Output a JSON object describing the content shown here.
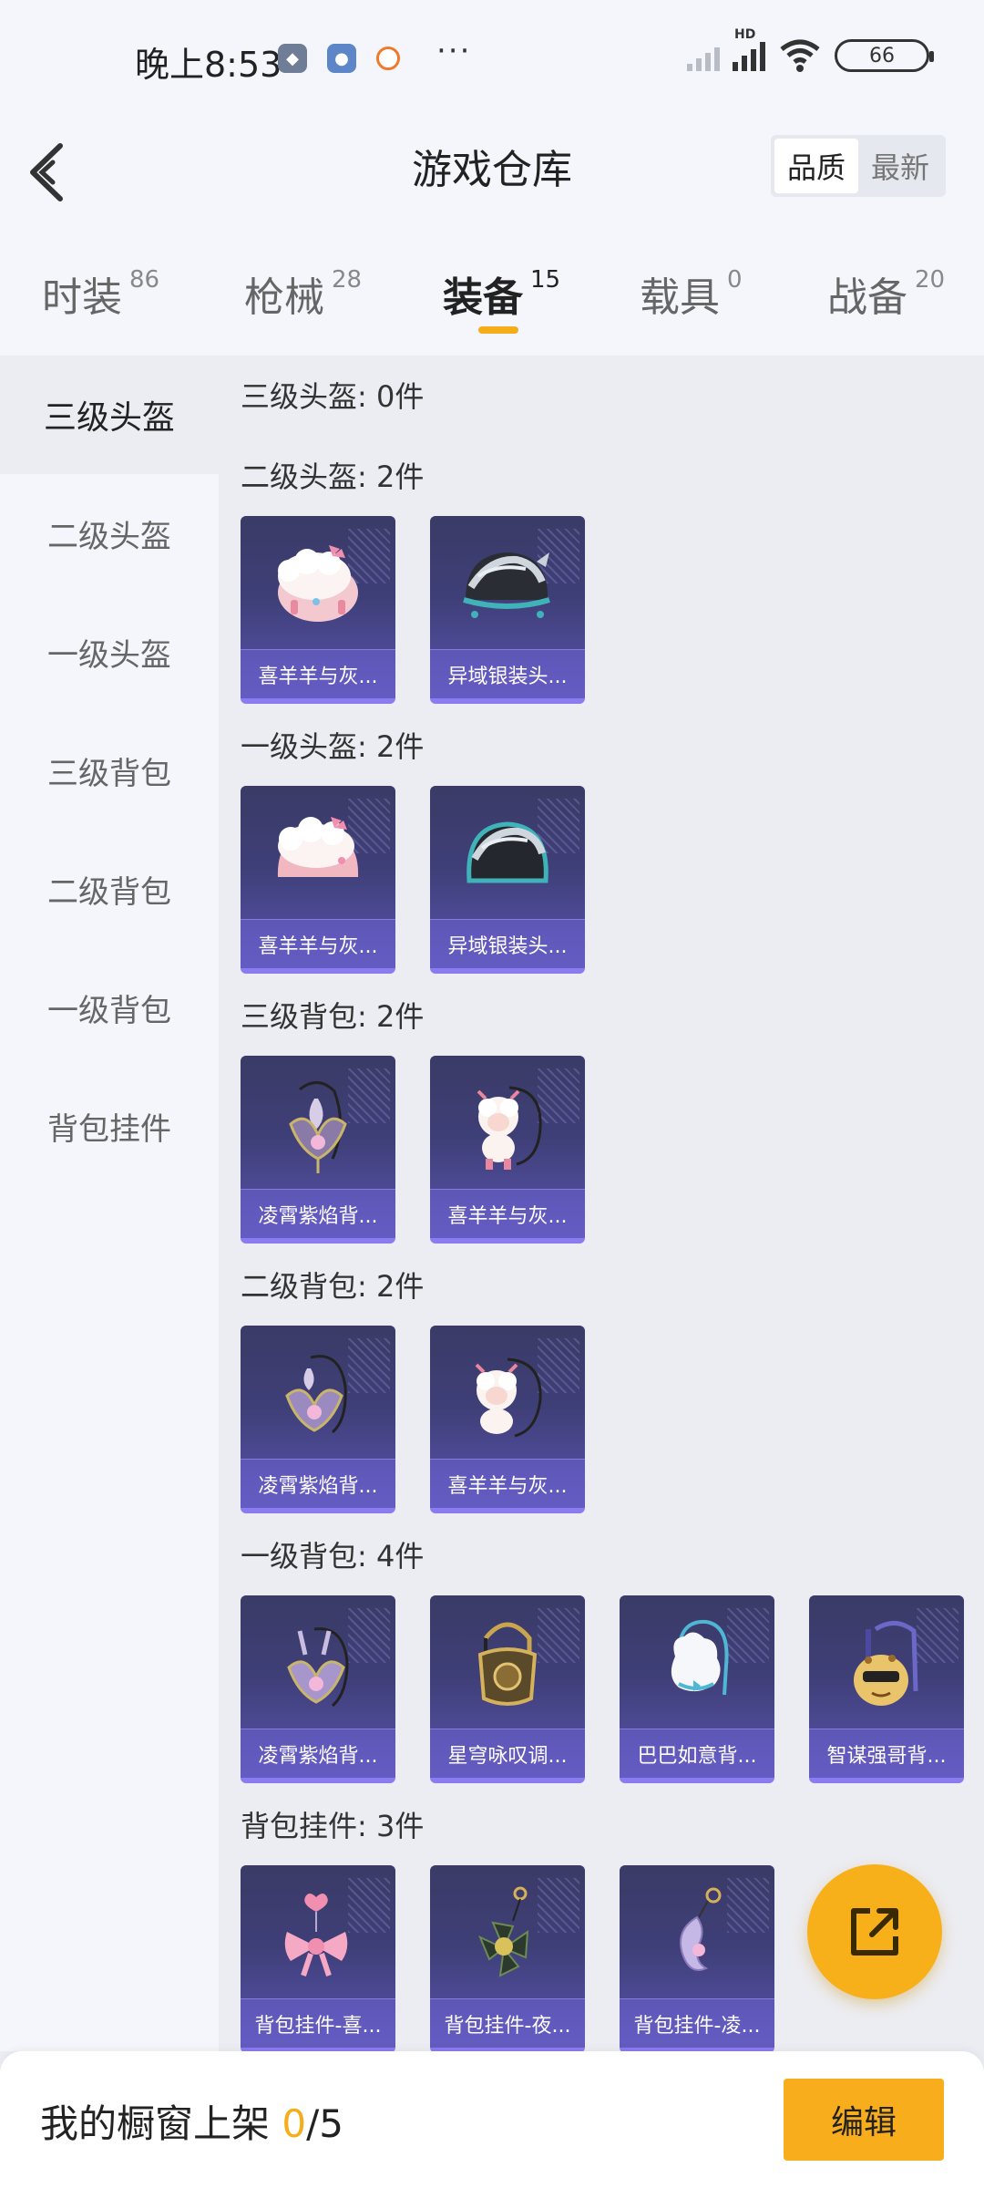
{
  "status_bar": {
    "time": "晚上8:53",
    "battery": "66",
    "network": "HD"
  },
  "header": {
    "title": "游戏仓库",
    "sort_options": [
      "品质",
      "最新"
    ],
    "active_sort": "品质"
  },
  "tabs": [
    {
      "label": "时装",
      "count": "86"
    },
    {
      "label": "枪械",
      "count": "28"
    },
    {
      "label": "装备",
      "count": "15"
    },
    {
      "label": "载具",
      "count": "0"
    },
    {
      "label": "战备",
      "count": "20"
    }
  ],
  "sidebar": {
    "items": [
      "三级头盔",
      "二级头盔",
      "一级头盔",
      "三级背包",
      "二级背包",
      "一级背包",
      "背包挂件"
    ]
  },
  "sections": [
    {
      "title": "三级头盔: 0件",
      "items": []
    },
    {
      "title": "二级头盔: 2件",
      "items": [
        {
          "name": "喜羊羊与灰...",
          "icon": "pink-sheep-helmet-icon"
        },
        {
          "name": "异域银装头...",
          "icon": "silver-helmet-icon"
        }
      ]
    },
    {
      "title": "一级头盔: 2件",
      "items": [
        {
          "name": "喜羊羊与灰...",
          "icon": "pink-sheep-helmet-icon"
        },
        {
          "name": "异域银装头...",
          "icon": "silver-helmet-icon"
        }
      ]
    },
    {
      "title": "三级背包: 2件",
      "items": [
        {
          "name": "凌霄紫焰背...",
          "icon": "purple-flame-backpack-icon"
        },
        {
          "name": "喜羊羊与灰...",
          "icon": "sheep-backpack-icon"
        }
      ]
    },
    {
      "title": "二级背包: 2件",
      "items": [
        {
          "name": "凌霄紫焰背...",
          "icon": "purple-flame-backpack-icon"
        },
        {
          "name": "喜羊羊与灰...",
          "icon": "sheep-backpack-icon"
        }
      ]
    },
    {
      "title": "一级背包: 4件",
      "items": [
        {
          "name": "凌霄紫焰背...",
          "icon": "purple-flame-backpack-icon"
        },
        {
          "name": "星穹咏叹调...",
          "icon": "gold-backpack-icon"
        },
        {
          "name": "巴巴如意背...",
          "icon": "white-bun-backpack-icon"
        },
        {
          "name": "智谋强哥背...",
          "icon": "cartoon-face-backpack-icon"
        }
      ]
    },
    {
      "title": "背包挂件: 3件",
      "items": [
        {
          "name": "背包挂件-喜...",
          "icon": "pink-bow-charm-icon"
        },
        {
          "name": "背包挂件-夜...",
          "icon": "dark-flower-charm-icon"
        },
        {
          "name": "背包挂件-凌...",
          "icon": "purple-flame-charm-icon"
        }
      ]
    }
  ],
  "bottom_bar": {
    "label": "我的橱窗上架",
    "count": "0",
    "total": "/5",
    "edit_button": "编辑"
  },
  "colors": {
    "accent": "#f8ad1c",
    "card_bg": "#3f3f78",
    "card_border": "#8a7cf0"
  }
}
